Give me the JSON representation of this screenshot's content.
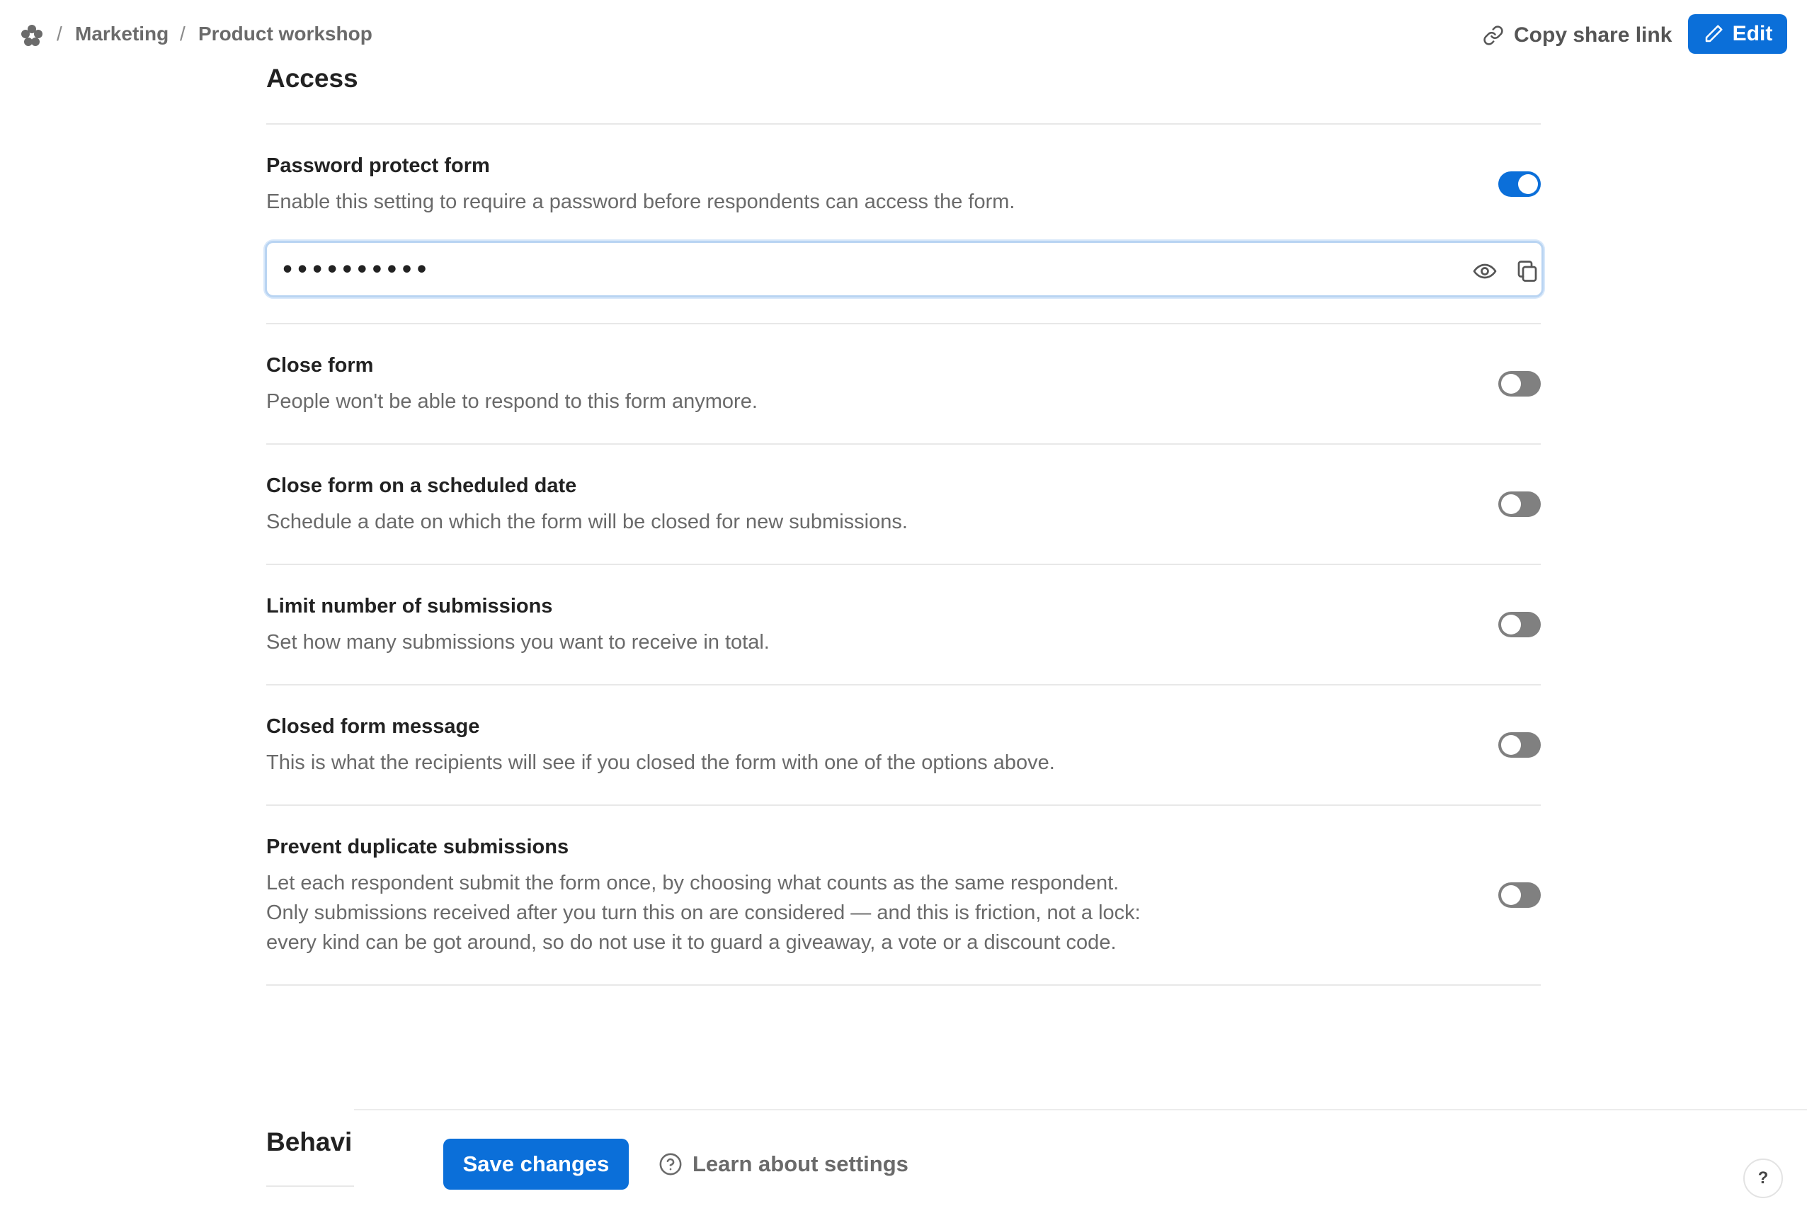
{
  "breadcrumb": {
    "items": [
      "Marketing",
      "Product workshop"
    ],
    "separator": "/"
  },
  "header": {
    "share_label": "Copy share link",
    "edit_label": "Edit"
  },
  "access": {
    "title": "Access",
    "password": {
      "title": "Password protect form",
      "description": "Enable this setting to require a password before respondents can access the form.",
      "enabled": true,
      "masked_value": "••••••••••"
    },
    "settings": [
      {
        "title": "Close form",
        "description": "People won't be able to respond to this form anymore.",
        "enabled": false
      },
      {
        "title": "Close form on a scheduled date",
        "description": "Schedule a date on which the form will be closed for new submissions.",
        "enabled": false
      },
      {
        "title": "Limit number of submissions",
        "description": "Set how many submissions you want to receive in total.",
        "enabled": false
      },
      {
        "title": "Closed form message",
        "description": "This is what the recipients will see if you closed the form with one of the options above.",
        "enabled": false
      }
    ],
    "duplicate": {
      "title": "Prevent duplicate submissions",
      "description_lines": [
        "Let each respondent submit the form once, by choosing what counts as the same respondent.",
        "Only submissions received after you turn this on are considered — and this is friction, not a lock:",
        "every kind can be got around, so do not use it to guard a giveaway, a vote or a discount code."
      ],
      "enabled": false
    }
  },
  "behavior": {
    "title": "Behavi"
  },
  "footer": {
    "save_label": "Save changes",
    "learn_label": "Learn about settings",
    "help_label": "?"
  },
  "colors": {
    "accent": "#0b6fd9",
    "toggle_off": "#808080"
  },
  "icons": {
    "logo": "flower-logo-icon",
    "share": "link-icon",
    "edit": "pencil-icon",
    "reveal": "eye-icon",
    "copy": "copy-icon",
    "learn": "question-circle-icon"
  }
}
